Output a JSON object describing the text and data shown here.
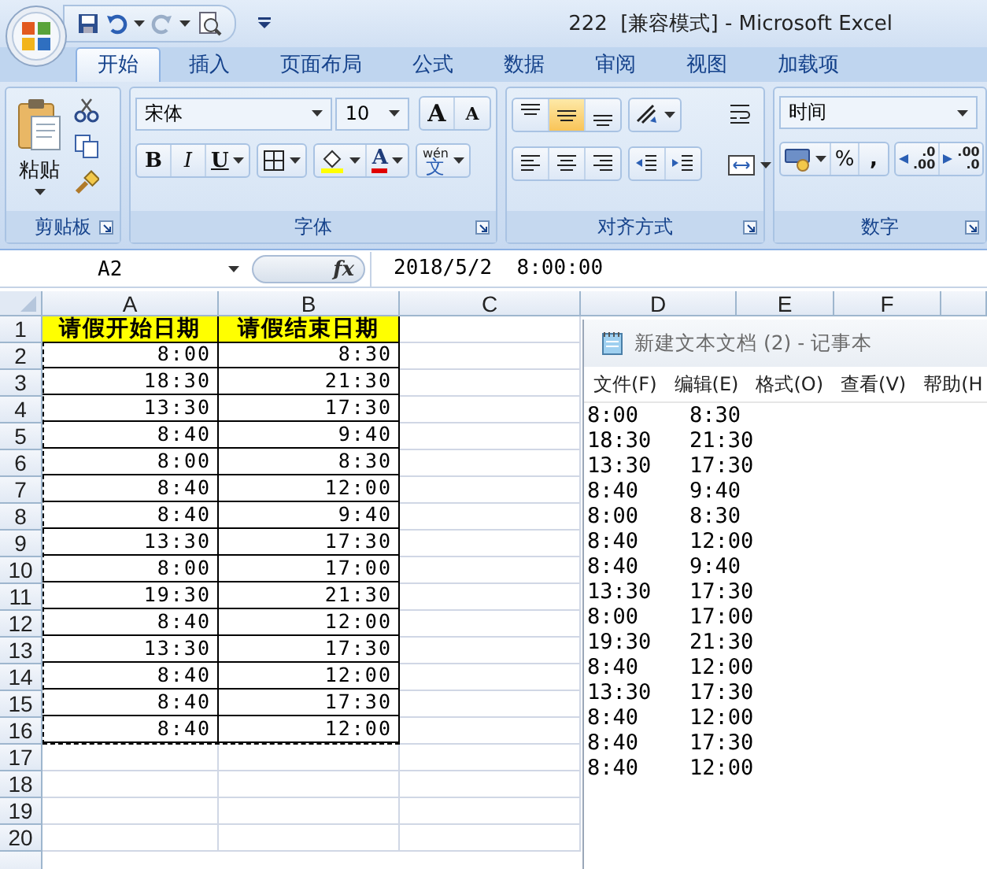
{
  "window": {
    "title": "222  [兼容模式] - Microsoft Excel"
  },
  "tabs": [
    {
      "label": "开始",
      "selected": true
    },
    {
      "label": "插入",
      "selected": false
    },
    {
      "label": "页面布局",
      "selected": false
    },
    {
      "label": "公式",
      "selected": false
    },
    {
      "label": "数据",
      "selected": false
    },
    {
      "label": "审阅",
      "selected": false
    },
    {
      "label": "视图",
      "selected": false
    },
    {
      "label": "加载项",
      "selected": false
    }
  ],
  "ribbon": {
    "clipboard": {
      "label": "剪贴板",
      "paste": "粘贴"
    },
    "font": {
      "label": "字体",
      "font_name": "宋体",
      "font_size": "10",
      "grow": "A",
      "shrink": "A",
      "bold": "B",
      "italic": "I",
      "underline": "U",
      "font_color": "A",
      "phonetic": [
        "wén",
        "文"
      ]
    },
    "alignment": {
      "label": "对齐方式",
      "vertical": [
        {
          "kind": "top",
          "selected": false
        },
        {
          "kind": "middle",
          "selected": true
        },
        {
          "kind": "bottom",
          "selected": false
        }
      ]
    },
    "number": {
      "label": "数字",
      "format": "时间",
      "percent": "%",
      "comma": ",",
      "increase_decimal": [
        ".0",
        ".00"
      ],
      "decrease_decimal": [
        ".00",
        ".0"
      ]
    }
  },
  "formula_bar": {
    "name_box": "A2",
    "fx": "fx",
    "value": "2018/5/2  8:00:00"
  },
  "sheet": {
    "columns": [
      "A",
      "B",
      "C",
      "D",
      "E",
      "F"
    ],
    "header": {
      "number": "1",
      "cells": [
        "请假开始日期",
        "请假结束日期"
      ]
    },
    "marquee": true,
    "rows": [
      {
        "number": "2",
        "start": "8:00",
        "end": "8:30"
      },
      {
        "number": "3",
        "start": "18:30",
        "end": "21:30"
      },
      {
        "number": "4",
        "start": "13:30",
        "end": "17:30"
      },
      {
        "number": "5",
        "start": "8:40",
        "end": "9:40"
      },
      {
        "number": "6",
        "start": "8:00",
        "end": "8:30"
      },
      {
        "number": "7",
        "start": "8:40",
        "end": "12:00"
      },
      {
        "number": "8",
        "start": "8:40",
        "end": "9:40"
      },
      {
        "number": "9",
        "start": "13:30",
        "end": "17:30"
      },
      {
        "number": "10",
        "start": "8:00",
        "end": "17:00"
      },
      {
        "number": "11",
        "start": "19:30",
        "end": "21:30"
      },
      {
        "number": "12",
        "start": "8:40",
        "end": "12:00"
      },
      {
        "number": "13",
        "start": "13:30",
        "end": "17:30"
      },
      {
        "number": "14",
        "start": "8:40",
        "end": "12:00"
      },
      {
        "number": "15",
        "start": "8:40",
        "end": "17:30"
      },
      {
        "number": "16",
        "start": "8:40",
        "end": "12:00"
      }
    ],
    "empty_rows": [
      "17",
      "18",
      "19",
      "20"
    ]
  },
  "notepad": {
    "title": "新建文本文档 (2) - 记事本",
    "menu": [
      "文件(F)",
      "编辑(E)",
      "格式(O)",
      "查看(V)",
      "帮助(H"
    ],
    "lines": [
      [
        "8:00",
        "8:30"
      ],
      [
        "18:30",
        "21:30"
      ],
      [
        "13:30",
        "17:30"
      ],
      [
        "8:40",
        "9:40"
      ],
      [
        "8:00",
        "8:30"
      ],
      [
        "8:40",
        "12:00"
      ],
      [
        "8:40",
        "9:40"
      ],
      [
        "13:30",
        "17:30"
      ],
      [
        "8:00",
        "17:00"
      ],
      [
        "19:30",
        "21:30"
      ],
      [
        "8:40",
        "12:00"
      ],
      [
        "13:30",
        "17:30"
      ],
      [
        "8:40",
        "12:00"
      ],
      [
        "8:40",
        "17:30"
      ],
      [
        "8:40",
        "12:00"
      ]
    ]
  }
}
